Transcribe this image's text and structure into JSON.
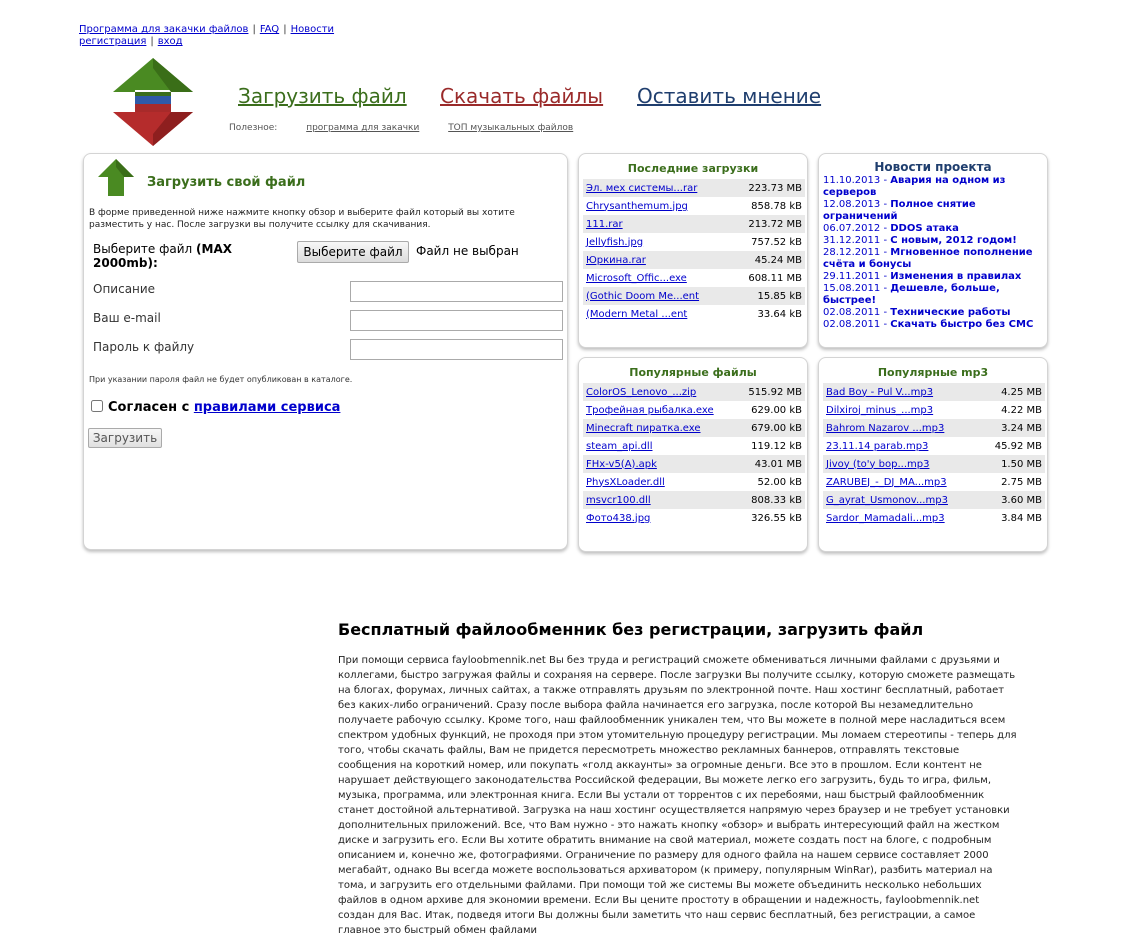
{
  "top_links": {
    "row1": [
      {
        "label": "Программа для закачки файлов"
      },
      {
        "label": "FAQ"
      },
      {
        "label": "Новости"
      }
    ],
    "row2": [
      {
        "label": "регистрация"
      },
      {
        "label": "вход"
      }
    ],
    "separator": "|"
  },
  "nav": {
    "upload": "Загрузить файл",
    "download": "Скачать файлы",
    "feedback": "Оставить мнение"
  },
  "useful": {
    "label": "Полезное:",
    "links": [
      "программа для закачки",
      "ТОП музыкальных файлов"
    ]
  },
  "upload_form": {
    "title": "Загрузить свой файл",
    "help": "В форме приведенной ниже нажмите кнопку обзор и выберите файл который вы хотите разместить у нас. После загрузки вы получите ссылку для скачивания.",
    "file_label": "Выберите файл",
    "file_limit": "(MAX 2000mb):",
    "file_button": "Выберите файл",
    "file_status": "Файл не выбран",
    "description_label": "Описание",
    "email_label": "Ваш e-mail",
    "password_label": "Пароль к файлу",
    "password_note": "При указании пароля файл не будет опубликован в каталоге.",
    "agree_prefix": "Согласен с",
    "agree_link": "правилами сервиса",
    "submit": "Загрузить"
  },
  "recent": {
    "title": "Последние загрузки",
    "files": [
      {
        "name": "Эл. мех системы...rar",
        "size": "223.73 MB"
      },
      {
        "name": "Chrysanthemum.jpg",
        "size": "858.78 kB"
      },
      {
        "name": "111.rar",
        "size": "213.72 MB"
      },
      {
        "name": "Jellyfish.jpg",
        "size": "757.52 kB"
      },
      {
        "name": "Юркина.rar",
        "size": "45.24 MB"
      },
      {
        "name": "Microsoft_Offic...exe",
        "size": "608.11 MB"
      },
      {
        "name": "(Gothic Doom Me...ent",
        "size": "15.85 kB"
      },
      {
        "name": "(Modern Metal ...ent",
        "size": "33.64 kB"
      }
    ]
  },
  "news": {
    "title": "Новости проекта",
    "items": [
      {
        "date": "11.10.2013",
        "text": "Авария на одном из серверов"
      },
      {
        "date": "12.08.2013",
        "text": "Полное снятие ограничений"
      },
      {
        "date": "06.07.2012",
        "text": "DDOS атака"
      },
      {
        "date": "31.12.2011",
        "text": "С новым, 2012 годом!"
      },
      {
        "date": "28.12.2011",
        "text": "Мгновенное пополнение счёта и бонусы"
      },
      {
        "date": "29.11.2011",
        "text": "Изменения в правилах"
      },
      {
        "date": "15.08.2011",
        "text": "Дешевле, больше, быстрее!"
      },
      {
        "date": "02.08.2011",
        "text": "Технические работы"
      },
      {
        "date": "02.08.2011",
        "text": "Скачать быстро без СМС"
      }
    ]
  },
  "popular": {
    "title": "Популярные файлы",
    "files": [
      {
        "name": "ColorOS_Lenovo_...zip",
        "size": "515.92 MB"
      },
      {
        "name": "Трофейная рыбалка.exe",
        "size": "629.00 kB"
      },
      {
        "name": "Minecraft пиратка.exe",
        "size": "679.00 kB"
      },
      {
        "name": "steam_api.dll",
        "size": "119.12 kB"
      },
      {
        "name": "FHx-v5(A).apk",
        "size": "43.01 MB"
      },
      {
        "name": "PhysXLoader.dll",
        "size": "52.00 kB"
      },
      {
        "name": "msvcr100.dll",
        "size": "808.33 kB"
      },
      {
        "name": "Фото438.jpg",
        "size": "326.55 kB"
      }
    ]
  },
  "popular_mp3": {
    "title": "Популярные mp3",
    "files": [
      {
        "name": "Bad Boy - Pul V...mp3",
        "size": "4.25 MB"
      },
      {
        "name": "Dilxiroj_minus_...mp3",
        "size": "4.22 MB"
      },
      {
        "name": "Bahrom Nazarov ...mp3",
        "size": "3.24 MB"
      },
      {
        "name": "23.11.14 parab.mp3",
        "size": "45.92 MB"
      },
      {
        "name": "Jivoy (to'y bop...mp3",
        "size": "1.50 MB"
      },
      {
        "name": "ZARUBEJ_-_DJ_MA...mp3",
        "size": "2.75 MB"
      },
      {
        "name": "G_ayrat_Usmonov...mp3",
        "size": "3.60 MB"
      },
      {
        "name": "Sardor_Mamadali...mp3",
        "size": "3.84 MB"
      }
    ]
  },
  "seo": {
    "title": "Бесплатный файлообменник без регистрации, загрузить файл",
    "text": "При помощи сервиса fayloobmennik.net Вы без труда и регистраций сможете обмениваться личными файлами с друзьями и коллегами, быстро загружая файлы и сохраняя на сервере. После загрузки Вы получите ссылку, которую сможете размещать на блогах, форумах, личных сайтах, а также отправлять друзьям по электронной почте. Наш хостинг бесплатный, работает без каких-либо ограничений. Сразу после выбора файла начинается его загрузка, после которой Вы незамедлительно получаете рабочую ссылку. Кроме того, наш файлообменник уникален тем, что Вы можете в полной мере насладиться всем спектром удобных функций, не проходя при этом утомительную процедуру регистрации. Мы ломаем стереотипы - теперь для того, чтобы скачать файлы, Вам не придется пересмотреть множество рекламных баннеров, отправлять текстовые сообщения на короткий номер, или покупать «голд аккаунты» за огромные деньги. Все это в прошлом. Если контент не нарушает действующего законодательства Российской федерации, Вы можете легко его загрузить, будь то игра, фильм, музыка, программа, или электронная книга. Если Вы устали от торрентов с их перебоями, наш быстрый файлообменник станет достойной альтернативой. Загрузка на наш хостинг осуществляется напрямую через браузер и не требует установки дополнительных приложений. Все, что Вам нужно - это нажать кнопку «обзор» и выбрать интересующий файл на жестком диске и загрузить его. Если Вы хотите обратить внимание на свой материал, можете создать пост на блоге, с подробным описанием и, конечно же, фотографиями. Ограничение по размеру для одного файла на нашем сервисе составляет 2000 мегабайт, однако Вы всегда можете воспользоваться архиватором (к примеру, популярным WinRar), разбить материал на тома, и загрузить его отдельными файлами. При помощи той же системы Вы можете объединить несколько небольших файлов в одном архиве для экономии времени. Если Вы цените простоту в обращении и надежность, fayloobmennik.net создан для Вас. Итак, подведя итоги Вы должны были заметить что наш сервис бесплатный, без регистрации, а самое главное это быстрый обмен файлами"
  },
  "colors": {
    "green": "#3b6e1c",
    "red": "#9a2a2a",
    "blue": "#1f3e6e",
    "link": "#0000cc"
  }
}
